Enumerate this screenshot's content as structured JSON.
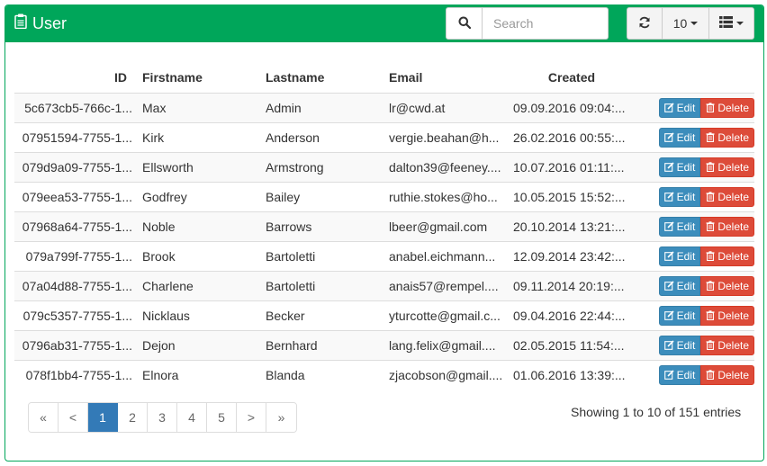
{
  "header": {
    "title": "User",
    "title_icon": "clipboard-icon"
  },
  "search": {
    "placeholder": "Search",
    "icon": "search-icon"
  },
  "toolbar": {
    "refresh_icon": "refresh-icon",
    "page_size": "10",
    "columns_icon": "list-icon"
  },
  "table": {
    "columns": [
      "ID",
      "Firstname",
      "Lastname",
      "Email",
      "Created"
    ],
    "edit_label": "Edit",
    "delete_label": "Delete",
    "rows": [
      [
        "5c673cb5-766c-1...",
        "Max",
        "Admin",
        "lr@cwd.at",
        "09.09.2016 09:04:..."
      ],
      [
        "07951594-7755-1...",
        "Kirk",
        "Anderson",
        "vergie.beahan@h...",
        "26.02.2016 00:55:..."
      ],
      [
        "079d9a09-7755-1...",
        "Ellsworth",
        "Armstrong",
        "dalton39@feeney....",
        "10.07.2016 01:11:..."
      ],
      [
        "079eea53-7755-1...",
        "Godfrey",
        "Bailey",
        "ruthie.stokes@ho...",
        "10.05.2015 15:52:..."
      ],
      [
        "07968a64-7755-1...",
        "Noble",
        "Barrows",
        "lbeer@gmail.com",
        "20.10.2014 13:21:..."
      ],
      [
        "079a799f-7755-1...",
        "Brook",
        "Bartoletti",
        "anabel.eichmann...",
        "12.09.2014 23:42:..."
      ],
      [
        "07a04d88-7755-1...",
        "Charlene",
        "Bartoletti",
        "anais57@rempel....",
        "09.11.2014 20:19:..."
      ],
      [
        "079c5357-7755-1...",
        "Nicklaus",
        "Becker",
        "yturcotte@gmail.c...",
        "09.04.2016 22:44:..."
      ],
      [
        "0796ab31-7755-1...",
        "Dejon",
        "Bernhard",
        "lang.felix@gmail....",
        "02.05.2015 11:54:..."
      ],
      [
        "078f1bb4-7755-1...",
        "Elnora",
        "Blanda",
        "zjacobson@gmail....",
        "01.06.2016 13:39:..."
      ]
    ]
  },
  "pagination": {
    "pages": [
      "«",
      "<",
      "1",
      "2",
      "3",
      "4",
      "5",
      ">",
      "»"
    ],
    "active": "1"
  },
  "footer": {
    "showing": "Showing 1 to 10 of 151 entries"
  },
  "colors": {
    "header": "#00a65a",
    "edit": "#3c8dbc",
    "delete": "#dd4b39",
    "active_page": "#337ab7"
  }
}
